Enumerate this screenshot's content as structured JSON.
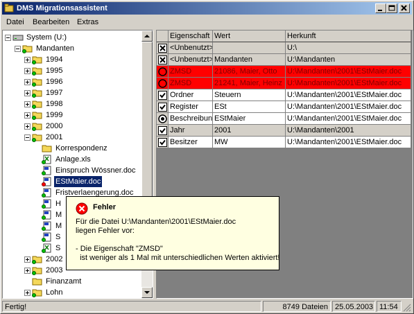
{
  "window": {
    "title": "DMS Migrationsassistent"
  },
  "menu": [
    "Datei",
    "Bearbeiten",
    "Extras"
  ],
  "tree": [
    {
      "label": "System (U:)",
      "icon": "drive",
      "selected": false
    },
    {
      "label": "Mandanten",
      "icon": "folder",
      "selected": false
    },
    {
      "label": "1994",
      "icon": "folder",
      "selected": false
    },
    {
      "label": "1995",
      "icon": "folder",
      "selected": false
    },
    {
      "label": "1996",
      "icon": "folder",
      "selected": false
    },
    {
      "label": "1997",
      "icon": "folder",
      "selected": false
    },
    {
      "label": "1998",
      "icon": "folder",
      "selected": false
    },
    {
      "label": "1999",
      "icon": "folder",
      "selected": false
    },
    {
      "label": "2000",
      "icon": "folder",
      "selected": false
    },
    {
      "label": "2001",
      "icon": "folder",
      "selected": false
    },
    {
      "label": "Korrespondenz",
      "icon": "folder-plain",
      "selected": false
    },
    {
      "label": "Anlage.xls",
      "icon": "xls",
      "selected": false
    },
    {
      "label": "Einspruch Wössner.doc",
      "icon": "doc",
      "selected": false
    },
    {
      "label": "EStMaier.doc",
      "icon": "doc-error",
      "selected": true
    },
    {
      "label": "Fristverlaengerung.doc",
      "icon": "doc",
      "selected": false
    },
    {
      "label": "H",
      "icon": "doc",
      "selected": false
    },
    {
      "label": "M",
      "icon": "doc",
      "selected": false
    },
    {
      "label": "M",
      "icon": "doc",
      "selected": false
    },
    {
      "label": "S",
      "icon": "doc",
      "selected": false
    },
    {
      "label": "S",
      "icon": "xls",
      "selected": false
    },
    {
      "label": "2002",
      "icon": "folder",
      "selected": false
    },
    {
      "label": "2003",
      "icon": "folder",
      "selected": false
    },
    {
      "label": "Finanzamt",
      "icon": "folder-plain",
      "selected": false
    },
    {
      "label": "Lohn",
      "icon": "folder",
      "selected": false
    }
  ],
  "grid": {
    "headers": [
      "Eigenschaft",
      "Wert",
      "Herkunft"
    ],
    "rows": [
      {
        "state": "x",
        "prop": "<Unbenutzt>",
        "value": "",
        "origin": "U:\\",
        "style": "gray"
      },
      {
        "state": "x",
        "prop": "<Unbenutzt>",
        "value": "Mandanten",
        "origin": "U:\\Mandanten",
        "style": "gray"
      },
      {
        "state": "error",
        "prop": "ZMSD",
        "value": "21086, Maier, Otto",
        "origin": "U:\\Mandanten\\2001\\EStMaier.doc",
        "style": "red"
      },
      {
        "state": "error",
        "prop": "ZMSD",
        "value": "21241, Maier, Heinz",
        "origin": "U:\\Mandanten\\2001\\EStMaier.doc",
        "style": "red"
      },
      {
        "state": "check",
        "prop": "Ordner",
        "value": "Steuern",
        "origin": "U:\\Mandanten\\2001\\EStMaier.doc",
        "style": "white"
      },
      {
        "state": "check",
        "prop": "Register",
        "value": "ESt",
        "origin": "U:\\Mandanten\\2001\\EStMaier.doc",
        "style": "white"
      },
      {
        "state": "radio",
        "prop": "Beschreibung",
        "value": "EStMaier",
        "origin": "U:\\Mandanten\\2001\\EStMaier.doc",
        "style": "white"
      },
      {
        "state": "check",
        "prop": "Jahr",
        "value": "2001",
        "origin": "U:\\Mandanten\\2001",
        "style": "gray"
      },
      {
        "state": "check",
        "prop": "Besitzer",
        "value": "MW",
        "origin": "U:\\Mandanten\\2001\\EStMaier.doc",
        "style": "white"
      }
    ]
  },
  "error_popup": {
    "title": "Fehler",
    "lines": [
      "Für die Datei U:\\Mandanten\\2001\\EStMaier.doc",
      "liegen Fehler vor:",
      "",
      "- Die Eigenschaft \"ZMSD\"",
      "  ist weniger als 1 Mal mit unterschiedlichen Werten aktiviert!"
    ]
  },
  "status": {
    "text": "Fertig!",
    "files": "8749 Dateien",
    "date": "25.05.2003",
    "time": "11:54"
  },
  "colors": {
    "title_start": "#0a246a",
    "title_end": "#a6caf0",
    "error_row": "#ff0000",
    "gray_row": "#d4d0c8",
    "selection": "#0a246a",
    "tooltip": "#ffffe1"
  }
}
